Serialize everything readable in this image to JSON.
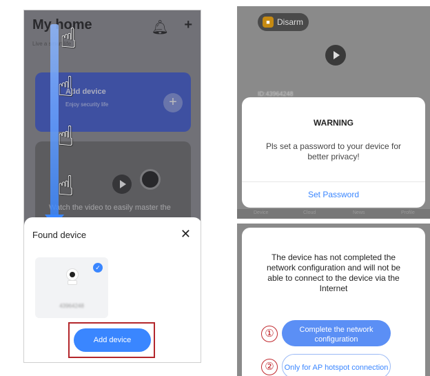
{
  "left_phone": {
    "title": "My home",
    "subtitle": "Live a smart life",
    "promo_title": "Add device",
    "promo_text": "Enjoy security life",
    "video_caption": "Watch the video to easily master the",
    "found_sheet": {
      "title": "Found device",
      "close_glyph": "✕",
      "device_id": "43964248",
      "add_button": "Add device"
    }
  },
  "right_top": {
    "disarm_label": "Disarm",
    "device_id": "ID:43964248",
    "warning": {
      "title": "WARNING",
      "message": "Pls set a password to your device for better privacy!",
      "action": "Set Password"
    },
    "tabs": [
      "Device",
      "Cloud",
      "News",
      "Profile"
    ]
  },
  "right_bottom": {
    "message": "The device has not completed the network configuration and will not be able to connect to the device via the Internet",
    "markers": [
      "①",
      "②"
    ],
    "btn_complete": "Complete the network configuration",
    "btn_ap": "Only for AP hotspot connection"
  },
  "colors": {
    "accent": "#3a86ff",
    "highlight_red": "#b3262b",
    "promo_blue": "#3f5bd3"
  }
}
